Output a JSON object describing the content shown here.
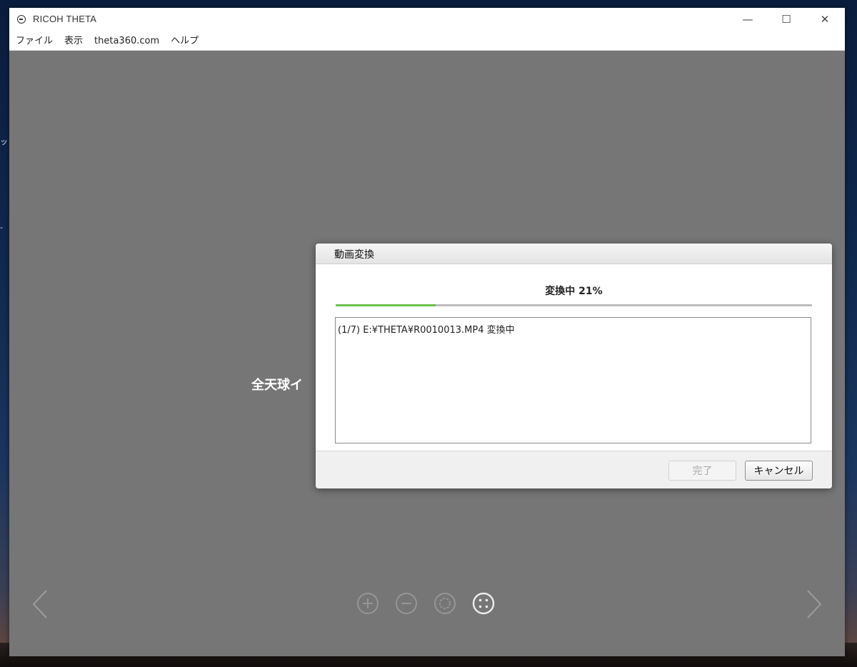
{
  "window": {
    "title": "RICOH THETA",
    "controls": {
      "minimize": "—",
      "maximize": "☐",
      "close": "✕"
    }
  },
  "menu": [
    {
      "label": "ファイル"
    },
    {
      "label": "表示"
    },
    {
      "label": "theta360.com"
    },
    {
      "label": "ヘルプ"
    }
  ],
  "desktop": {
    "edge_texts": [
      "ッ",
      "-"
    ]
  },
  "viewer": {
    "center_text": "全天球イ"
  },
  "dialog": {
    "title": "動画変換",
    "status": "変換中  21%",
    "progress": 0.21,
    "progress_color": "#6cc04a",
    "log_line": "(1/7) E:¥THETA¥R0010013.MP4 変換中",
    "done_button": "完了",
    "cancel_button": "キャンセル"
  },
  "tools": [
    {
      "icon": "zoom-in-icon"
    },
    {
      "icon": "zoom-out-icon"
    },
    {
      "icon": "settings-icon"
    },
    {
      "icon": "view-mode-icon"
    }
  ]
}
